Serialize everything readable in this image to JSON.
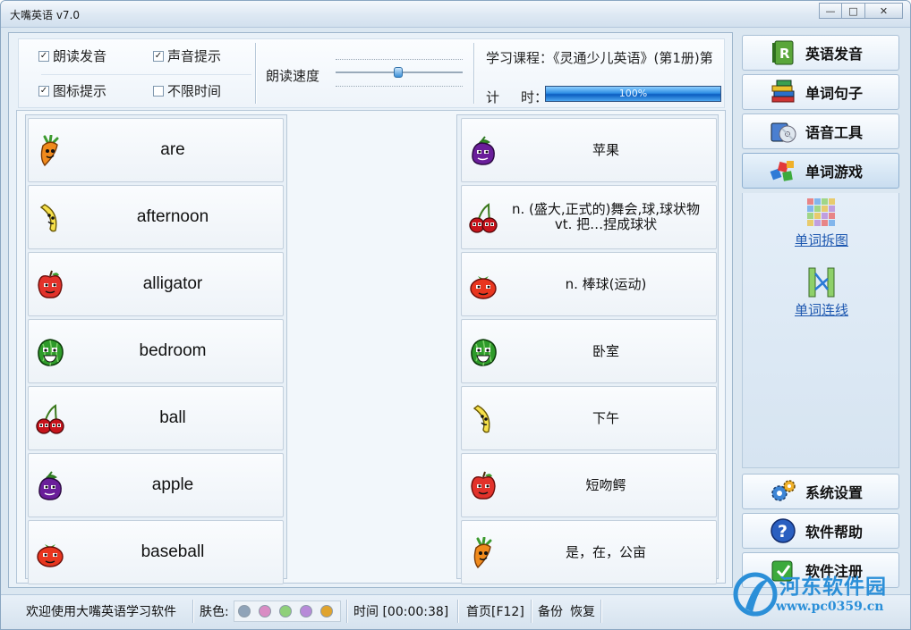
{
  "window": {
    "title": "大嘴英语 v7.0"
  },
  "options": {
    "read_sound": {
      "label": "朗读发音",
      "checked": true
    },
    "sound_hint": {
      "label": "声音提示",
      "checked": true
    },
    "icon_hint": {
      "label": "图标提示",
      "checked": true
    },
    "unlimited_time": {
      "label": "不限时间",
      "checked": false
    },
    "speed_label": "朗读速度",
    "speed_level": 0.49,
    "course": "学习课程：《灵通少儿英语》(第1册)第",
    "timer_label_1": "计",
    "timer_label_2": "时：",
    "progress_text": "100%",
    "progress_value": 1.0
  },
  "left_cards": [
    {
      "word": "are",
      "fruit": "carrot-icon"
    },
    {
      "word": "afternoon",
      "fruit": "banana-icon"
    },
    {
      "word": "alligator",
      "fruit": "apple-icon"
    },
    {
      "word": "bedroom",
      "fruit": "watermelon-icon"
    },
    {
      "word": "ball",
      "fruit": "cherry-icon"
    },
    {
      "word": "apple",
      "fruit": "eggplant-icon"
    },
    {
      "word": "baseball",
      "fruit": "tomato-icon"
    }
  ],
  "right_cards": [
    {
      "meaning": "苹果",
      "fruit": "eggplant-icon"
    },
    {
      "meaning": "n. (盛大,正式的)舞会,球,球状物\nvt. 把…捏成球状",
      "fruit": "cherry-icon"
    },
    {
      "meaning": "n. 棒球(运动)",
      "fruit": "tomato-icon"
    },
    {
      "meaning": "卧室",
      "fruit": "watermelon-icon"
    },
    {
      "meaning": "下午",
      "fruit": "banana-icon"
    },
    {
      "meaning": "短吻鳄",
      "fruit": "apple-icon"
    },
    {
      "meaning": "是，在，公亩",
      "fruit": "carrot-icon"
    }
  ],
  "sidebar": {
    "items": [
      {
        "label": "英语发音",
        "icon": "book-r-icon"
      },
      {
        "label": "单词句子",
        "icon": "books-stack-icon"
      },
      {
        "label": "语音工具",
        "icon": "cd-tools-icon"
      },
      {
        "label": "单词游戏",
        "icon": "cubes-icon",
        "active": true
      }
    ],
    "games": [
      {
        "label": "单词拆图",
        "icon": "puzzle-grid-icon"
      },
      {
        "label": "单词连线",
        "icon": "connect-lines-icon"
      }
    ],
    "bottom": [
      {
        "label": "系统设置",
        "icon": "gears-icon"
      },
      {
        "label": "软件帮助",
        "icon": "help-icon"
      },
      {
        "label": "软件注册",
        "icon": "register-icon"
      }
    ]
  },
  "status": {
    "welcome": "欢迎使用大嘴英语学习软件",
    "skin_label": "肤色:",
    "skin_colors": [
      "#8fa3b8",
      "#d98cc4",
      "#8fd07a",
      "#b78ad8",
      "#e0a42e"
    ],
    "time": "时间 [00:00:38]",
    "home": "首页[F12]",
    "backup": "备份",
    "restore": "恢复"
  },
  "watermark": {
    "title": "河东软件园",
    "url": "www.pc0359.cn"
  }
}
